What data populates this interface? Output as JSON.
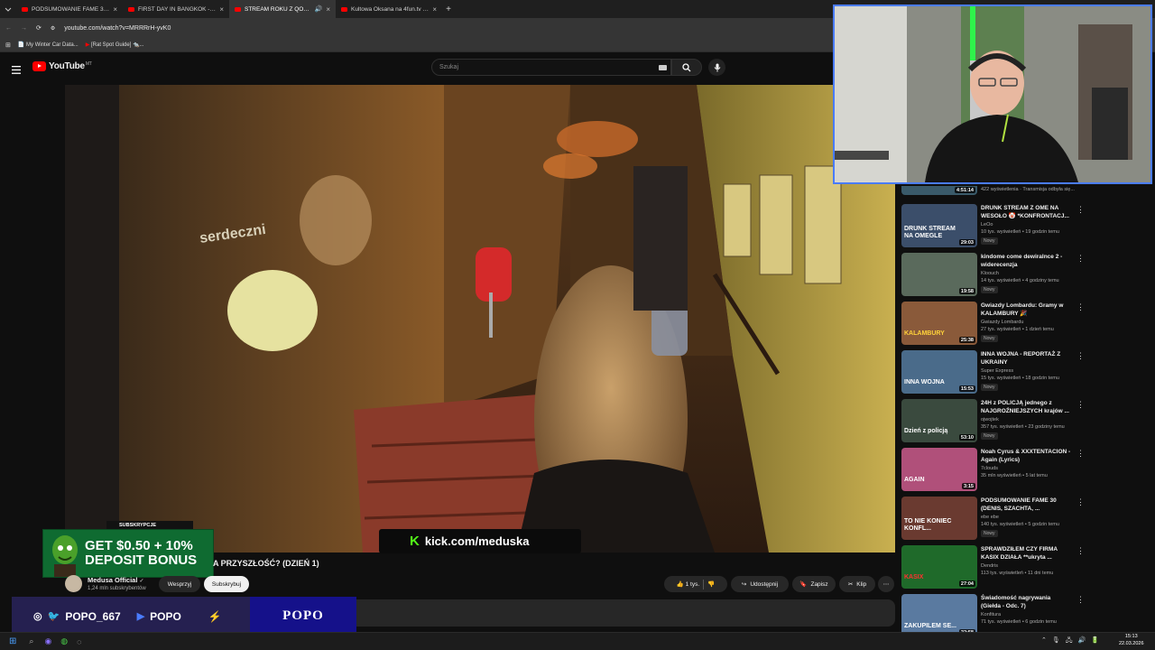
{
  "browser": {
    "tabs": [
      {
        "label": "PODSUMOWANIE FAME 30 (DE",
        "active": false
      },
      {
        "label": "FIRST DAY IN BANGKOK - Yo",
        "active": false
      },
      {
        "label": "STREAM ROKU Z QOOSIK",
        "active": true
      },
      {
        "label": "Kultowa Oksana na 4fun.tv - dy",
        "active": false
      }
    ],
    "url": "youtube.com/watch?v=MRRRrH-yvK0",
    "bookmarks": [
      "My Winter Car Data...",
      "[Rat Spot Guide] 🐀..."
    ]
  },
  "youtube": {
    "logo": "YouTube",
    "region": "MT",
    "search_placeholder": "Szukaj"
  },
  "video": {
    "title": "A PRZYSZŁOŚĆ? (DZIEŃ 1)",
    "channel": "Medusa Official",
    "subscribers": "1,24 mln subskrybentów",
    "support_label": "Wesprzyj",
    "subscribe_label": "Subskrybuj",
    "likes": "1 tys.",
    "share_label": "Udostępnij",
    "save_label": "Zapisz",
    "clip_label": "Klip",
    "sign_text": "serdeczni",
    "kick_url": "kick.com/meduska"
  },
  "overlays": {
    "promo_header": "SUBSKRYPCJE",
    "promo_line1": "GET $0.50 + 10%",
    "promo_line2": "DEPOSIT BONUS",
    "handle": "POPO_667",
    "name": "POPO",
    "brand": "POPO"
  },
  "sidebar": {
    "partial": {
      "duration": "4:51:14",
      "meta": "422 wyświetlenia · Transmisja odbyła się..."
    },
    "items": [
      {
        "title": "DRUNK STREAM Z OME NA WESOŁO 🤡 *KONFRONTACJ...",
        "channel": "LeOo",
        "meta": "10 tys. wyświetleń • 19 godzin temu",
        "badge": "Nowy",
        "duration": "29:03",
        "thumb": "#3b4e6a",
        "thumb_text": "DRUNK STREAM NA OMEGLE",
        "thumb_color": "#ffffff"
      },
      {
        "title": "kindome come dewiralnce 2 - widerecenzja",
        "channel": "Kloouch",
        "meta": "14 tys. wyświetleń • 4 godziny temu",
        "badge": "Nowy",
        "duration": "19:58",
        "thumb": "#5a6a5c",
        "thumb_text": "",
        "thumb_color": "#ffffff"
      },
      {
        "title": "Gwiazdy Lombardu: Gramy w KALAMBURY 🎉",
        "channel": "Gwiazdy Lombardu",
        "meta": "27 tys. wyświetleń • 1 dzień temu",
        "badge": "Nowy",
        "duration": "25:38",
        "thumb": "#8a5a3a",
        "thumb_text": "KALAMBURY",
        "thumb_color": "#ffd23a"
      },
      {
        "title": "INNA WOJNA - REPORTAŻ Z UKRAINY",
        "channel": "Super Express",
        "meta": "15 tys. wyświetleń • 18 godzin temu",
        "badge": "Nowy",
        "duration": "15:53",
        "thumb": "#4a6b8a",
        "thumb_text": "INNA WOJNA",
        "thumb_color": "#ffffff"
      },
      {
        "title": "24H z POLICJĄ jednego z NAJGROŹNIEJSZYCH krajów ...",
        "channel": "ojwojtek",
        "meta": "357 tys. wyświetleń • 23 godziny temu",
        "badge": "Nowy",
        "duration": "53:10",
        "thumb": "#3a4a3e",
        "thumb_text": "Dzień z policją",
        "thumb_color": "#ffffff"
      },
      {
        "title": "Noah Cyrus & XXXTENTACION - Again (Lyrics)",
        "channel": "7clouds",
        "meta": "35 mln wyświetleń • 5 lat temu",
        "badge": "",
        "duration": "3:15",
        "thumb": "#b0507a",
        "thumb_text": "AGAIN",
        "thumb_color": "#ffffff"
      },
      {
        "title": "PODSUMOWANIE FAME 30 (DENIS, SZACHTA, ...",
        "channel": "ebe ebe",
        "meta": "140 tys. wyświetleń • 5 godzin temu",
        "badge": "Nowy",
        "duration": "",
        "thumb": "#6a3a30",
        "thumb_text": "TO NIE KONIEC KONFL...",
        "thumb_color": "#ffffff"
      },
      {
        "title": "SPRAWDZIŁEM CZY FIRMA KASIX DZIAŁA **ukryta ...",
        "channel": "Dendris",
        "meta": "113 tys. wyświetleń • 11 dni temu",
        "badge": "",
        "duration": "27:04",
        "thumb": "#1f6a2a",
        "thumb_text": "KASIX",
        "thumb_color": "#ff3030"
      },
      {
        "title": "Świadomość nagrywania (Giełda - Odc. 7)",
        "channel": "Konfitura",
        "meta": "71 tys. wyświetleń • 6 godzin temu",
        "badge": "",
        "duration": "22:58",
        "thumb": "#5a7aa0",
        "thumb_text": "ZAKUPILEM SE...",
        "thumb_color": "#ffffff"
      }
    ]
  },
  "taskbar": {
    "time": "15:13",
    "date": "22.03.2026"
  },
  "colors": {
    "accent_red": "#ff0000",
    "background": "#0f0f0f",
    "kick_green": "#53fc18",
    "webcam_border": "#4a7cff"
  }
}
